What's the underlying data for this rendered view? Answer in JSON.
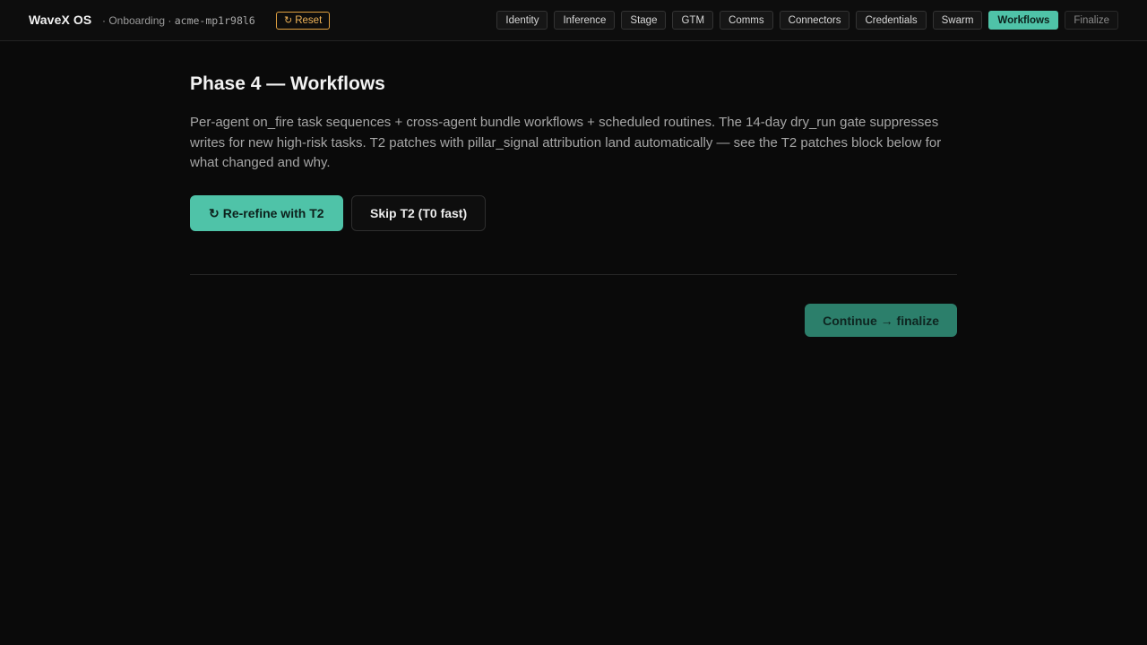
{
  "header": {
    "brand": "WaveX OS",
    "breadcrumb_prefix": "· Onboarding ·",
    "tenant_id": "acme-mp1r98l6",
    "reset_icon": "rotate-ccw-icon",
    "reset_label": "Reset",
    "steps": [
      {
        "label": "Identity",
        "state": "done"
      },
      {
        "label": "Inference",
        "state": "done"
      },
      {
        "label": "Stage",
        "state": "done"
      },
      {
        "label": "GTM",
        "state": "done"
      },
      {
        "label": "Comms",
        "state": "done"
      },
      {
        "label": "Connectors",
        "state": "done"
      },
      {
        "label": "Credentials",
        "state": "done"
      },
      {
        "label": "Swarm",
        "state": "done"
      },
      {
        "label": "Workflows",
        "state": "active"
      },
      {
        "label": "Finalize",
        "state": "future"
      }
    ]
  },
  "main": {
    "title": "Phase 4 — Workflows",
    "description": "Per-agent on_fire task sequences + cross-agent bundle workflows + scheduled routines. The 14-day dry_run gate suppresses writes for new high-risk tasks. T2 patches with pillar_signal attribution land automatically — see the T2 patches block below for what changed and why.",
    "rerefine_icon": "refresh-icon",
    "rerefine_label": "Re-refine with T2",
    "skip_label": "Skip T2 (T0 fast)",
    "continue_label": "Continue → finalize"
  },
  "colors": {
    "accent": "#4fc3a8",
    "accent_dim": "#2c7f6b",
    "warning": "#f0b458",
    "background": "#0a0a0a"
  }
}
